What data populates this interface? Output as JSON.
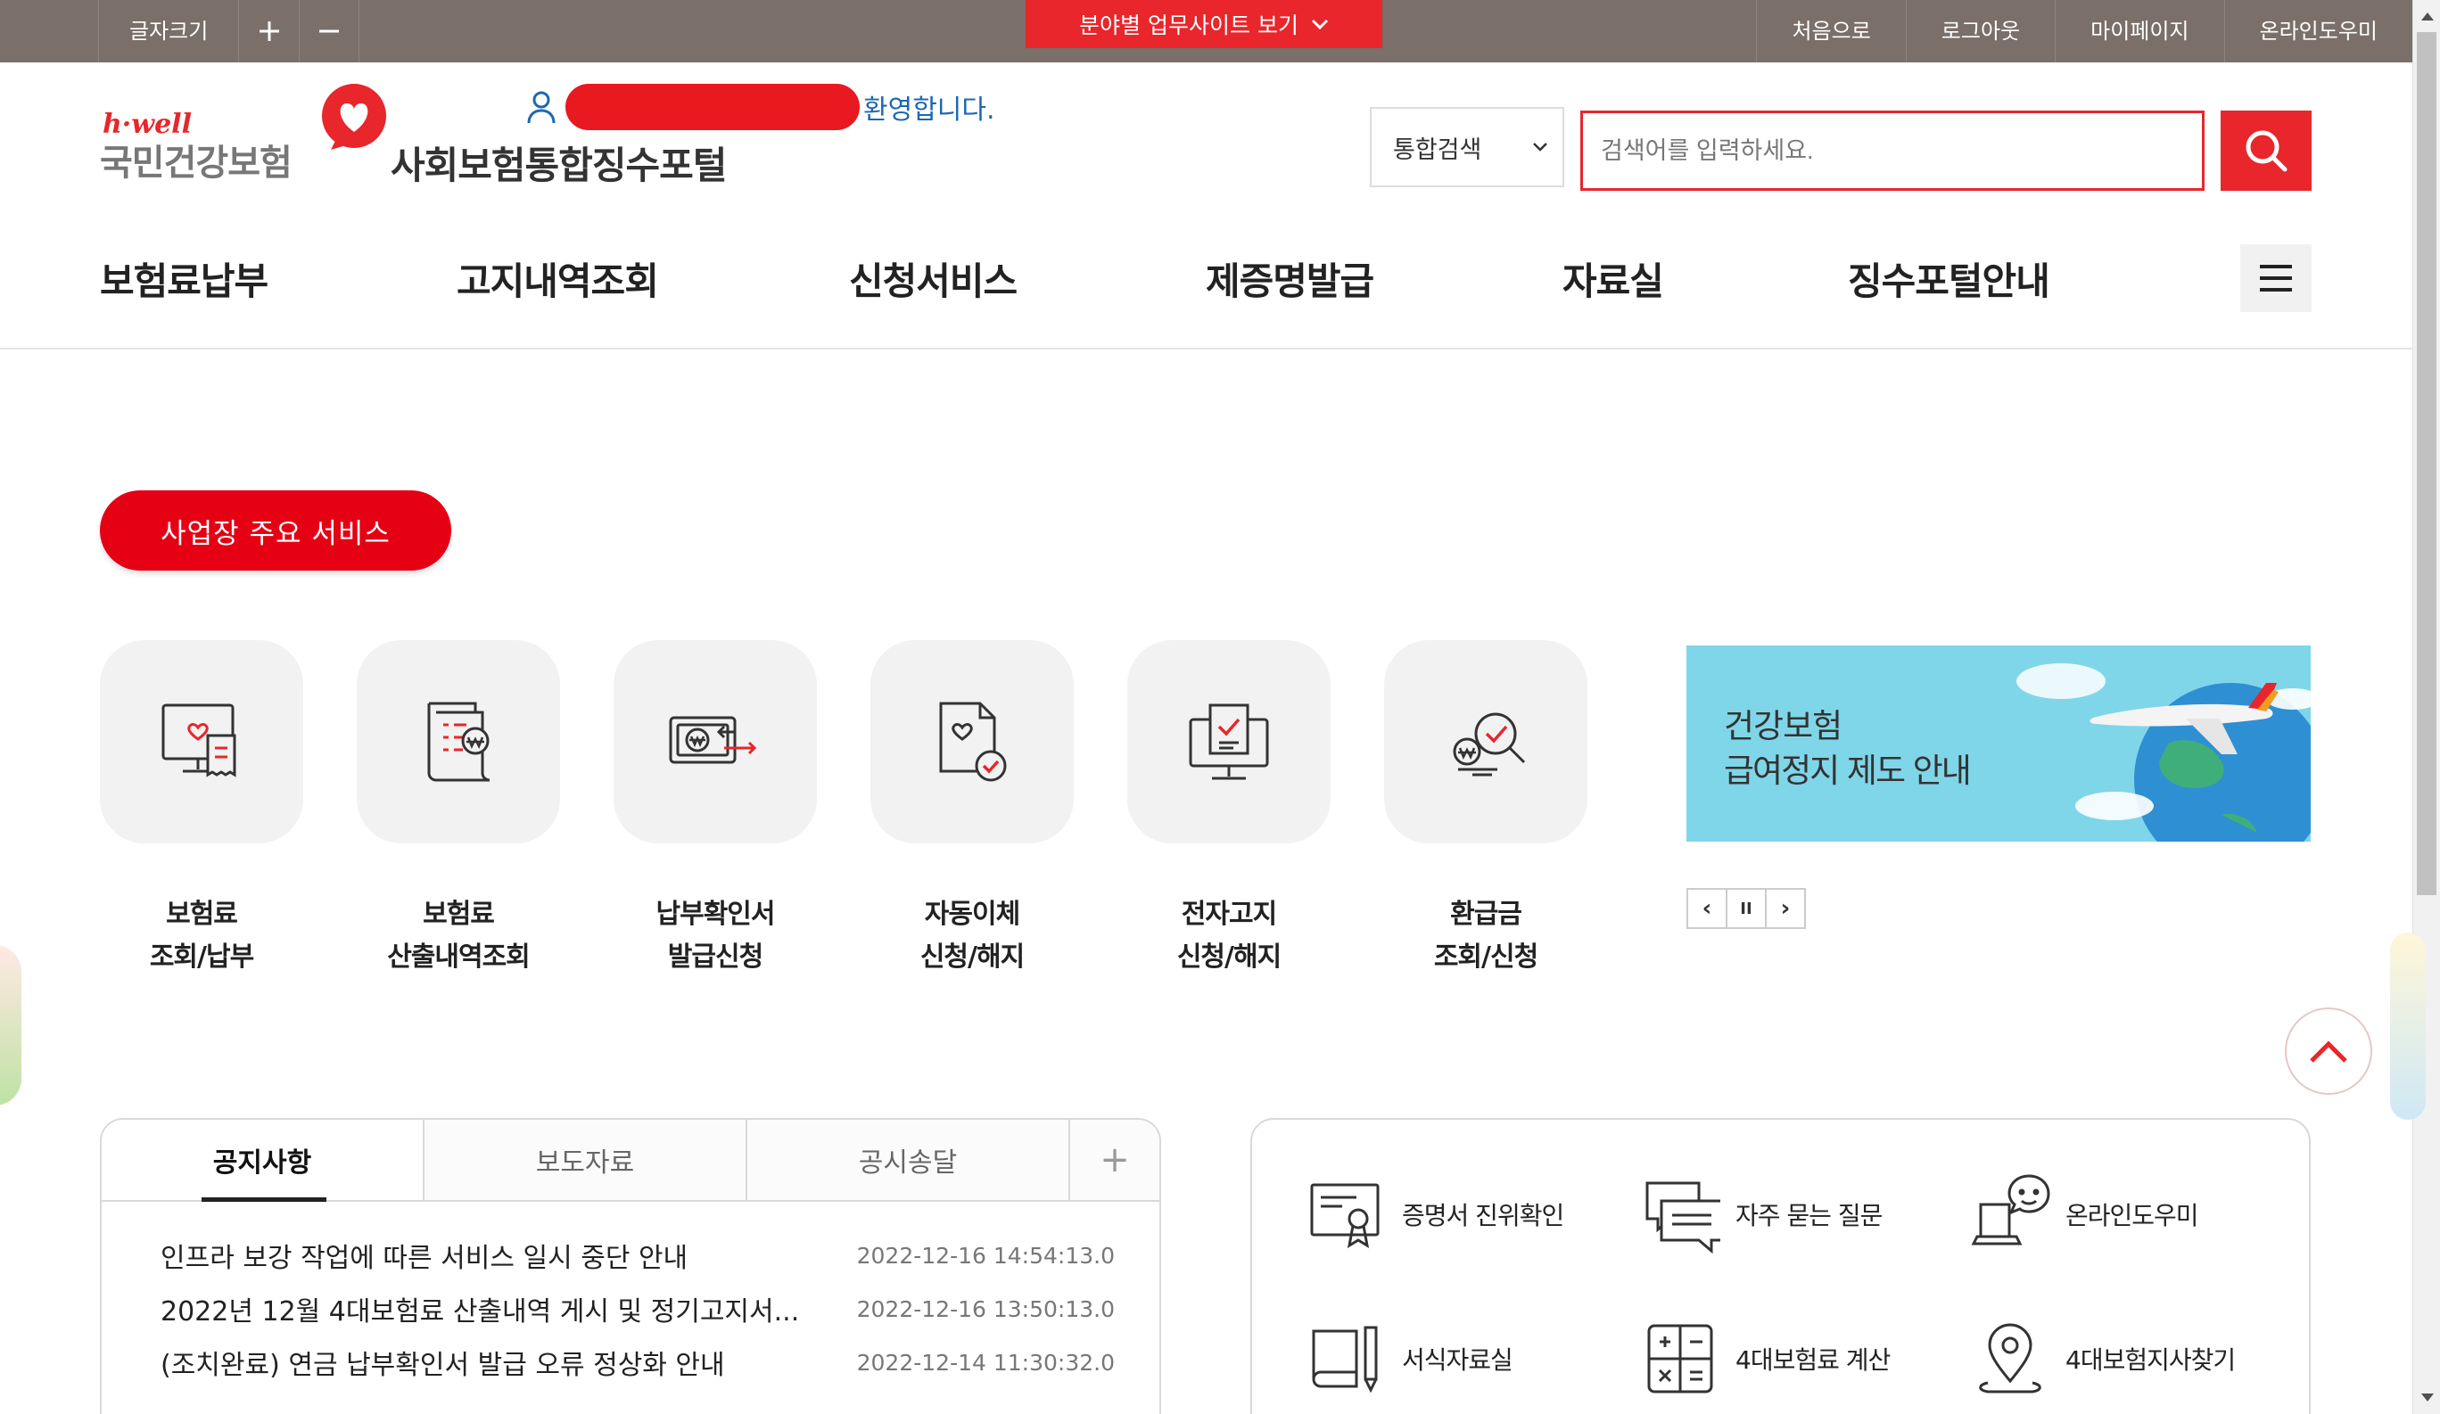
{
  "topbar": {
    "font_size_label": "글자크기",
    "font_plus_label": "+",
    "font_minus_label": "−",
    "sites_label": "분야별 업무사이트 보기",
    "links": [
      "처음으로",
      "로그아웃",
      "마이페이지",
      "온라인도우미"
    ]
  },
  "header": {
    "hwell": "h·well",
    "nhis_name": "국민건강보험",
    "portal_name": "사회보험통합징수포털",
    "welcome": "환영합니다.",
    "search_select": "통합검색",
    "search_placeholder": "검색어를 입력하세요."
  },
  "gnb": [
    "보험료납부",
    "고지내역조회",
    "신청서비스",
    "제증명발급",
    "자료실",
    "징수포털안내"
  ],
  "main": {
    "section_title": "사업장 주요 서비스",
    "services": [
      {
        "label": "보험료\n조회/납부",
        "icon": "monitor-bill-icon"
      },
      {
        "label": "보험료\n산출내역조회",
        "icon": "document-won-icon"
      },
      {
        "label": "납부확인서\n발급신청",
        "icon": "wallet-transfer-icon"
      },
      {
        "label": "자동이체\n신청/해지",
        "icon": "doc-check-icon"
      },
      {
        "label": "전자고지\n신청/해지",
        "icon": "computer-check-icon"
      },
      {
        "label": "환급금\n조회/신청",
        "icon": "won-search-icon"
      }
    ],
    "banner": {
      "line1": "건강보험",
      "line2": "급여정지 제도 안내"
    },
    "slider_controls": {
      "prev": "‹",
      "pause": "II",
      "next": "›"
    }
  },
  "board": {
    "tabs": [
      "공지사항",
      "보도자료",
      "공시송달"
    ],
    "more": "+",
    "rows": [
      {
        "title": "인프라 보강 작업에 따른 서비스 일시 중단 안내",
        "date": "2022-12-16 14:54:13.0"
      },
      {
        "title": "2022년 12월 4대보험료 산출내역 게시 및 정기고지서...",
        "date": "2022-12-16 13:50:13.0"
      },
      {
        "title": "(조치완료) 연금 납부확인서 발급 오류 정상화 안내",
        "date": "2022-12-14 11:30:32.0"
      }
    ]
  },
  "quick_links": [
    {
      "label": "증명서 진위확인",
      "icon": "certificate-icon"
    },
    {
      "label": "자주 묻는 질문",
      "icon": "chat-icon"
    },
    {
      "label": "온라인도우미",
      "icon": "laptop-helper-icon"
    },
    {
      "label": "서식자료실",
      "icon": "book-pen-icon"
    },
    {
      "label": "4대보험료 계산",
      "icon": "calculator-icon"
    },
    {
      "label": "4대보험지사찾기",
      "icon": "location-pin-icon"
    }
  ],
  "colors": {
    "brand_red": "#e8262b",
    "topbar": "#7a6f69",
    "welcome_blue": "#1d67b1"
  }
}
